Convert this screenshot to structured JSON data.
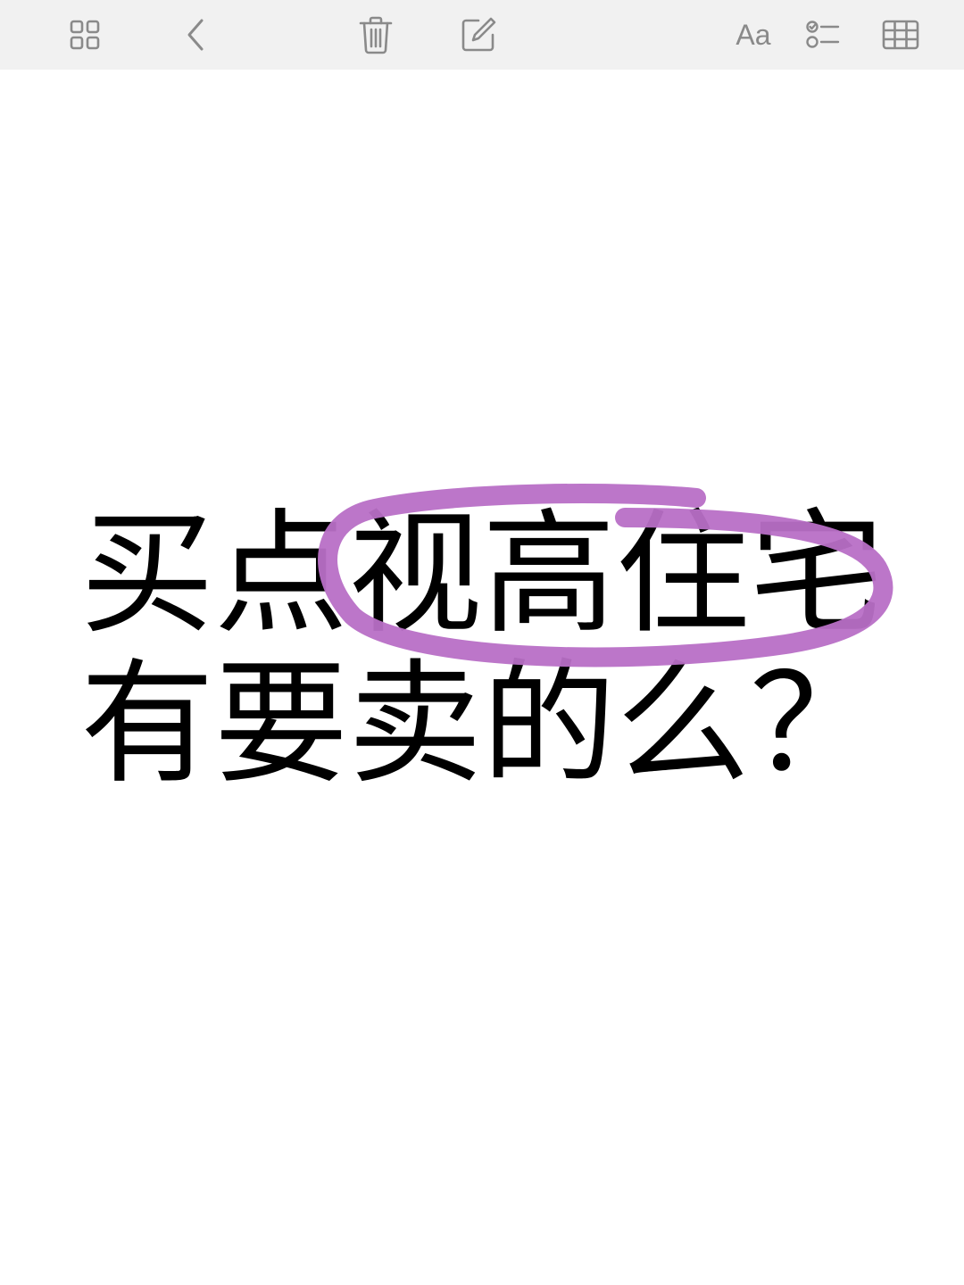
{
  "toolbar": {
    "font_button_label": "Aa",
    "icons": [
      "grid-view-icon",
      "back-chevron-icon",
      "trash-icon",
      "compose-icon",
      "font-format-icon",
      "checklist-icon",
      "table-icon"
    ],
    "icon_color": "#8a8a8a"
  },
  "note": {
    "line1": "买点视高住宅",
    "line2": "有要卖的么？",
    "text_color": "#000000"
  },
  "annotation": {
    "stroke_color": "#b86fc6",
    "description_target": "视高住宅"
  }
}
